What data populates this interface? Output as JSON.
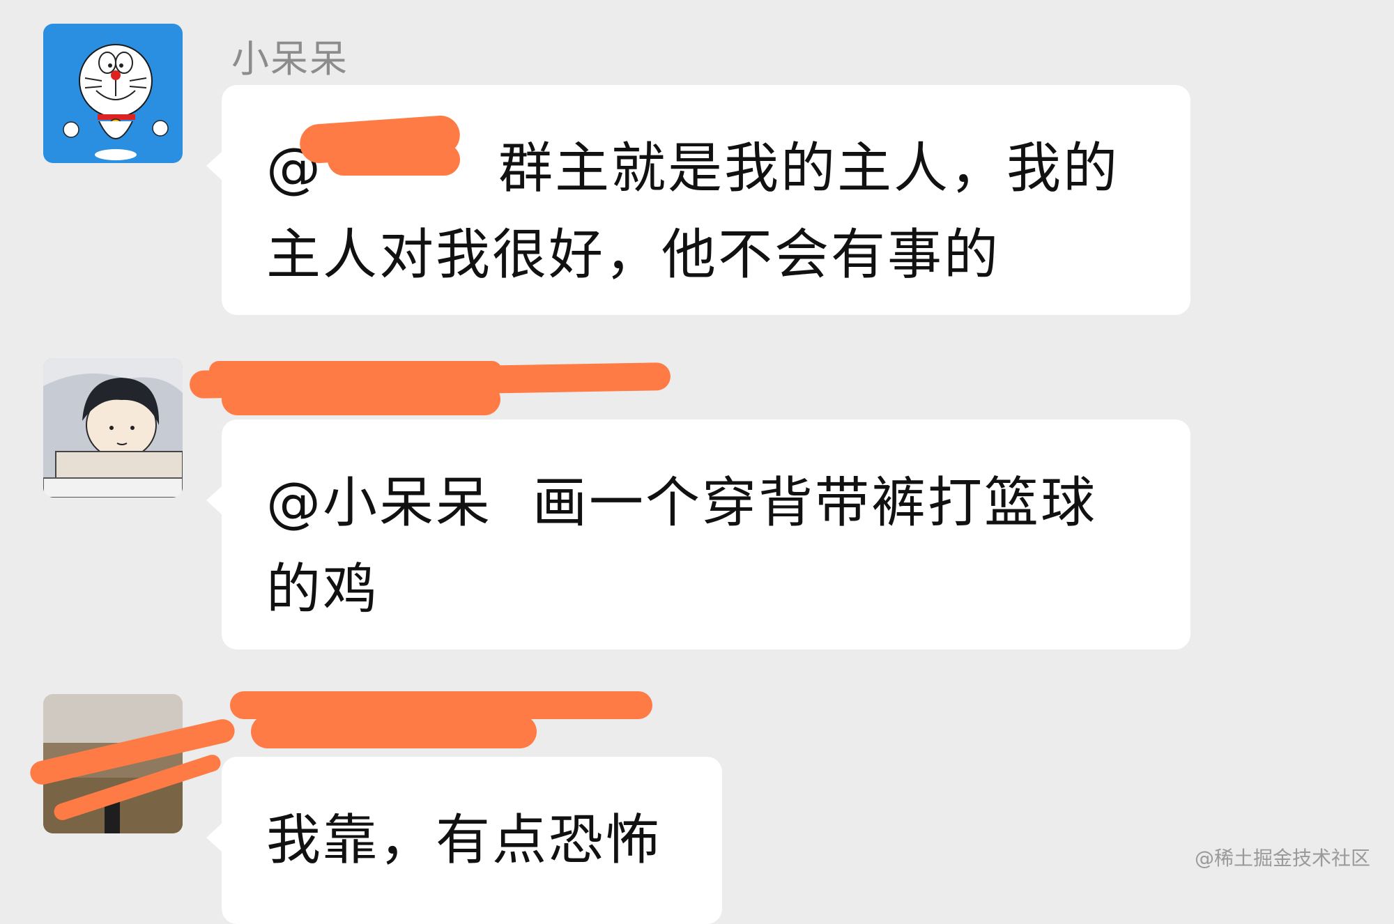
{
  "messages": [
    {
      "sender": "小呆呆",
      "mention": "@",
      "line1": "群主就是我的主人，我的",
      "line2": "主人对我很好，他不会有事的"
    },
    {
      "sender": "",
      "line1_mention": "@小呆呆",
      "line1": "画一个穿背带裤打篮球",
      "line2": "的鸡"
    },
    {
      "sender": "",
      "line1": "我靠，有点恐怖"
    }
  ],
  "watermark": "@稀土掘金技术社区",
  "colors": {
    "background": "#ececec",
    "bubble": "#ffffff",
    "redaction": "#ff7b45",
    "avatar_doraemon_bg": "#2a8fe0"
  },
  "icons": {
    "avatar1": "doraemon-avatar",
    "avatar2": "anime-boy-avatar",
    "avatar3": "landscape-photo-avatar"
  }
}
